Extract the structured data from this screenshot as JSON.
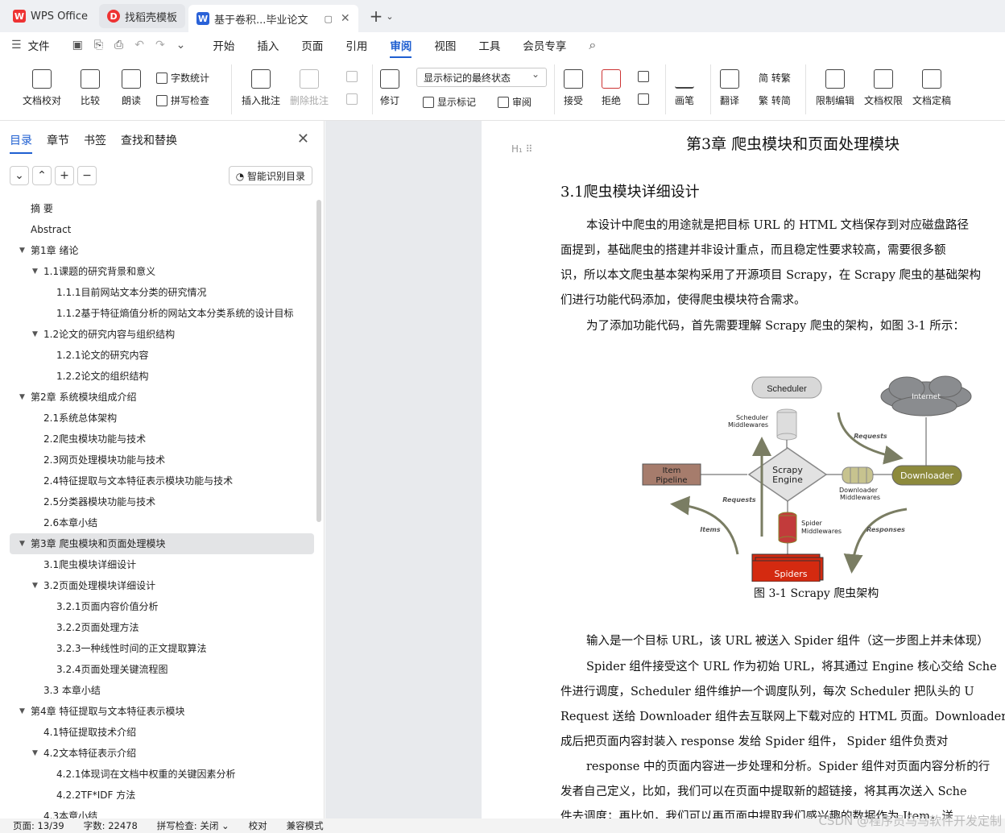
{
  "tabs": [
    {
      "label": "WPS Office",
      "icon": "wps-logo-icon"
    },
    {
      "label": "找稻壳模板",
      "icon": "docer-icon"
    },
    {
      "label": "基于卷积...毕业论文",
      "icon": "word-doc-icon"
    }
  ],
  "menu": {
    "file": "文件",
    "items": [
      "开始",
      "插入",
      "页面",
      "引用",
      "审阅",
      "视图",
      "工具",
      "会员专享"
    ],
    "active": "审阅"
  },
  "ribbon": {
    "doc_proof": "文档校对",
    "compare": "比较",
    "read_aloud": "朗读",
    "word_count": "字数统计",
    "spell_check": "拼写检查",
    "insert_comment": "插入批注",
    "delete_comment": "删除批注",
    "track": "修订",
    "display_dropdown": "显示标记的最终状态",
    "show_marks": "显示标记",
    "review": "审阅",
    "accept": "接受",
    "reject": "拒绝",
    "ink": "画笔",
    "translate": "翻译",
    "to_traditional": "简 转繁",
    "to_simplified": "繁 转简",
    "restrict": "限制编辑",
    "permission": "文档权限",
    "finalize": "文档定稿"
  },
  "nav": {
    "tabs": [
      "目录",
      "章节",
      "书签",
      "查找和替换"
    ],
    "active_tab": "目录",
    "smart_button": "智能识别目录",
    "items": [
      {
        "label": "摘  要",
        "level": 0,
        "arrow": false
      },
      {
        "label": "Abstract",
        "level": 0,
        "arrow": false
      },
      {
        "label": "第1章  绪论",
        "level": 0,
        "arrow": true
      },
      {
        "label": "1.1课题的研究背景和意义",
        "level": 1,
        "arrow": true
      },
      {
        "label": "1.1.1目前网站文本分类的研究情况",
        "level": 2,
        "arrow": false
      },
      {
        "label": "1.1.2基于特征熵值分析的网站文本分类系统的设计目标",
        "level": 2,
        "arrow": false
      },
      {
        "label": "1.2论文的研究内容与组织结构",
        "level": 1,
        "arrow": true
      },
      {
        "label": "1.2.1论文的研究内容",
        "level": 2,
        "arrow": false
      },
      {
        "label": "1.2.2论文的组织结构",
        "level": 2,
        "arrow": false
      },
      {
        "label": "第2章  系统模块组成介绍",
        "level": 0,
        "arrow": true
      },
      {
        "label": "2.1系统总体架构",
        "level": 1,
        "arrow": false
      },
      {
        "label": "2.2爬虫模块功能与技术",
        "level": 1,
        "arrow": false
      },
      {
        "label": "2.3网页处理模块功能与技术",
        "level": 1,
        "arrow": false
      },
      {
        "label": "2.4特征提取与文本特征表示模块功能与技术",
        "level": 1,
        "arrow": false
      },
      {
        "label": "2.5分类器模块功能与技术",
        "level": 1,
        "arrow": false
      },
      {
        "label": "2.6本章小结",
        "level": 1,
        "arrow": false
      },
      {
        "label": "第3章  爬虫模块和页面处理模块",
        "level": 0,
        "arrow": true,
        "selected": true
      },
      {
        "label": "3.1爬虫模块详细设计",
        "level": 1,
        "arrow": false
      },
      {
        "label": "3.2页面处理模块详细设计",
        "level": 1,
        "arrow": true
      },
      {
        "label": "3.2.1页面内容价值分析",
        "level": 2,
        "arrow": false
      },
      {
        "label": "3.2.2页面处理方法",
        "level": 2,
        "arrow": false
      },
      {
        "label": "3.2.3一种线性时间的正文提取算法",
        "level": 2,
        "arrow": false
      },
      {
        "label": "3.2.4页面处理关键流程图",
        "level": 2,
        "arrow": false
      },
      {
        "label": "3.3 本章小结",
        "level": 1,
        "arrow": false
      },
      {
        "label": "第4章  特征提取与文本特征表示模块",
        "level": 0,
        "arrow": true
      },
      {
        "label": "4.1特征提取技术介绍",
        "level": 1,
        "arrow": false
      },
      {
        "label": "4.2文本特征表示介绍",
        "level": 1,
        "arrow": true
      },
      {
        "label": "4.2.1体现词在文档中权重的关键因素分析",
        "level": 2,
        "arrow": false
      },
      {
        "label": "4.2.2TF*IDF 方法",
        "level": 2,
        "arrow": false
      },
      {
        "label": "4.3本章小结",
        "level": 1,
        "arrow": false
      }
    ]
  },
  "doc": {
    "chapter_title": "第3章  爬虫模块和页面处理模块",
    "section_title": "3.1爬虫模块详细设计",
    "para1": [
      "本设计中爬虫的用途就是把目标 URL 的 HTML 文档保存到对应磁盘路径",
      "面提到，基础爬虫的搭建并非设计重点，而且稳定性要求较高，需要很多额",
      "识，所以本文爬虫基本架构采用了开源项目 Scrapy，在 Scrapy 爬虫的基础架构",
      "们进行功能代码添加，使得爬虫模块符合需求。"
    ],
    "para2": "为了添加功能代码，首先需要理解 Scrapy 爬虫的架构，如图 3-1 所示：",
    "figure": {
      "scheduler": "Scheduler",
      "scheduler_mw": [
        "Scheduler",
        "Middlewares"
      ],
      "internet": "Internet",
      "requests_top": "Requests",
      "item_pipeline": [
        "Item",
        "Pipeline"
      ],
      "engine": [
        "Scrapy",
        "Engine"
      ],
      "downloader": "Downloader",
      "downloader_mw": [
        "Downloader",
        "Middlewares"
      ],
      "requests_left": "Requests",
      "items": "Items",
      "spider_mw": [
        "Spider",
        "Middlewares"
      ],
      "responses": "Responses",
      "spiders": "Spiders"
    },
    "caption": "图 3-1 Scrapy 爬虫架构",
    "para3": "输入是一个目标 URL，该 URL 被送入 Spider 组件（这一步图上并未体现）",
    "para4": [
      "Spider 组件接受这个 URL 作为初始 URL，将其通过 Engine 核心交给 Sche",
      "件进行调度，Scheduler 组件维护一个调度队列，每次 Scheduler 把队头的 U",
      "Request 送给 Downloader 组件去互联网上下载对应的 HTML 页面。Downloader",
      "成后把页面内容封装入 response 发给 Spider 组件， Spider 组件负责对"
    ],
    "para5": [
      "response 中的页面内容进一步处理和分析。Spider 组件对页面内容分析的行",
      "发者自己定义，比如，我们可以在页面中提取新的超链接，将其再次送入 Sche",
      "件去调度；再比如，我们可以再页面中提取我们感兴趣的数据作为 Item，送"
    ]
  },
  "status": {
    "page": "页面: 13/39",
    "words": "字数: 22478",
    "spell": "拼写检查: 关闭 ⌄",
    "proof": "校对",
    "compat": "兼容模式"
  },
  "watermark": "CSDN @程序员马马软件开发定制"
}
